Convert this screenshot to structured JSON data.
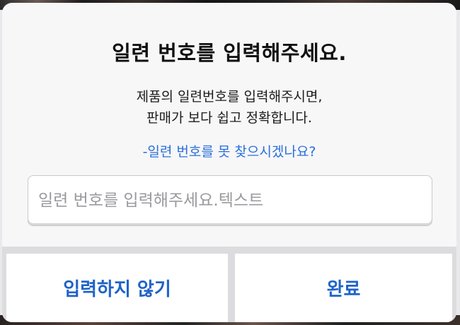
{
  "dialog": {
    "title": "일련 번호를 입력해주세요.",
    "message_line1": "제품의 일련번호를 입력해주시면,",
    "message_line2": "판매가 보다 쉽고 정확합니다.",
    "help_link": "-일련 번호를 못 찾으시겠나요?",
    "input": {
      "placeholder": "일련 번호를 입력해주세요.텍스트",
      "value": ""
    },
    "buttons": {
      "skip_label": "입력하지 않기",
      "done_label": "완료"
    }
  },
  "colors": {
    "accent": "#1f63c9",
    "link": "#2a6fdb",
    "dialog_bg": "#f7f7f8"
  }
}
